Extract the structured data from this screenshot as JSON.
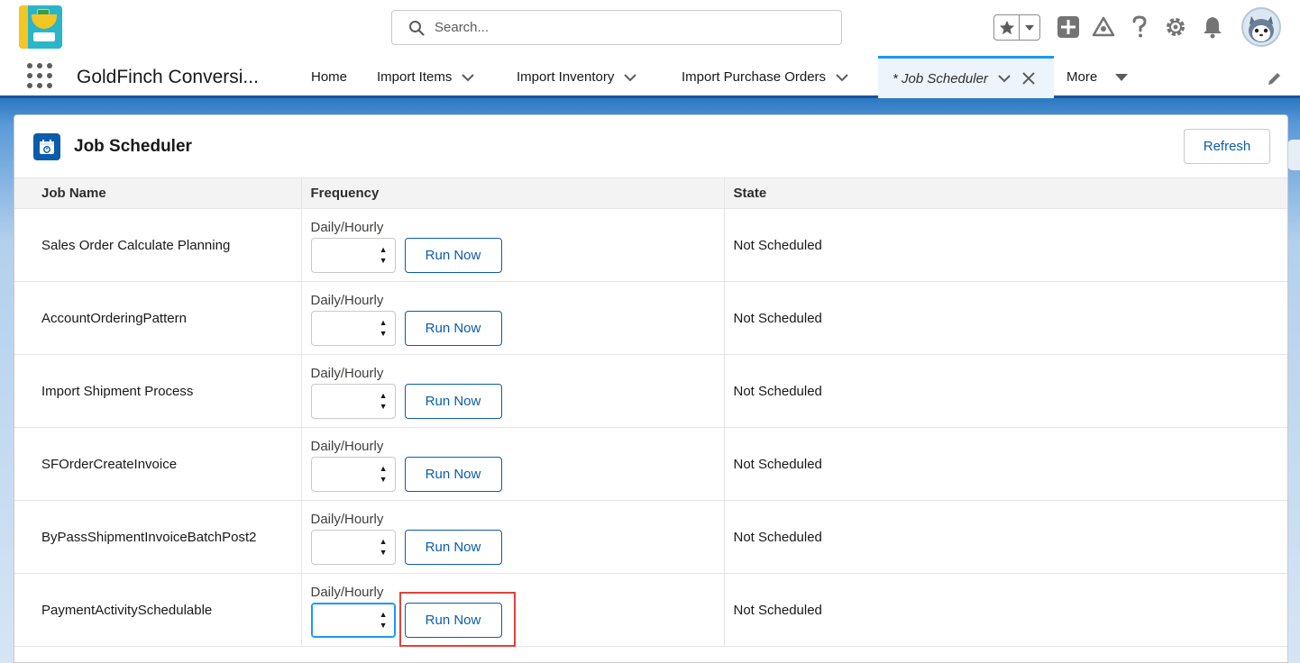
{
  "header": {
    "search_placeholder": "Search...",
    "avatar": "astro-avatar"
  },
  "nav": {
    "app_name": "GoldFinch Conversi...",
    "tabs": [
      {
        "label": "Home"
      },
      {
        "label": "Import Items"
      },
      {
        "label": "Import Inventory"
      },
      {
        "label": "Import Purchase Orders"
      },
      {
        "label": "* Job Scheduler"
      },
      {
        "label": "More"
      }
    ]
  },
  "card": {
    "title": "Job Scheduler",
    "refresh_label": "Refresh"
  },
  "table": {
    "columns": [
      "Job Name",
      "Frequency",
      "State"
    ],
    "frequency_label": "Daily/Hourly",
    "run_label": "Run Now",
    "rows": [
      {
        "name": "Sales Order Calculate Planning",
        "state": "Not Scheduled"
      },
      {
        "name": "AccountOrderingPattern",
        "state": "Not Scheduled"
      },
      {
        "name": "Import Shipment Process",
        "state": "Not Scheduled"
      },
      {
        "name": "SFOrderCreateInvoice",
        "state": "Not Scheduled"
      },
      {
        "name": "ByPassShipmentInvoiceBatchPost2",
        "state": "Not Scheduled"
      },
      {
        "name": "PaymentActivitySchedulable",
        "state": "Not Scheduled"
      }
    ]
  },
  "colors": {
    "brand": "#0b5cab",
    "nav_border": "#1b5297",
    "highlight": "#e0413a"
  }
}
